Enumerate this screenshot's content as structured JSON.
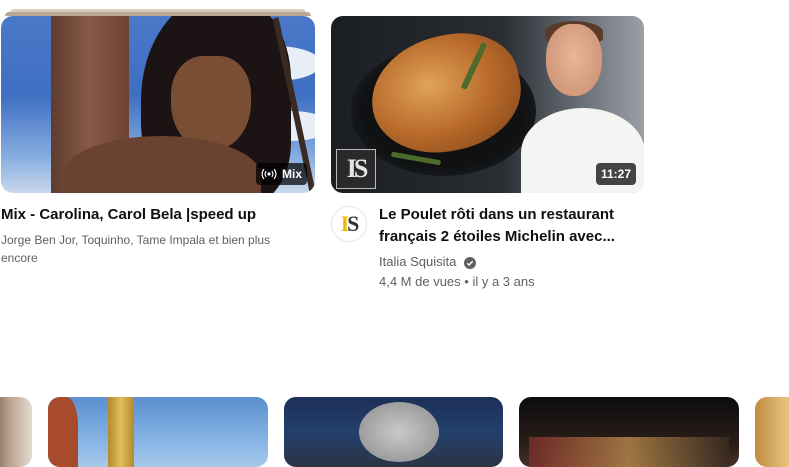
{
  "videos": [
    {
      "title": "Mix - Carolina, Carol Bela |speed up",
      "subtitle": "Jorge Ben Jor, Toquinho, Tame Impala et bien plus encore",
      "badge": "Mix",
      "badge_icon": "radio-broadcast-icon"
    },
    {
      "title_line1": "Le Poulet rôti dans un restaurant",
      "title_line2": "français 2 étoiles Michelin avec...",
      "duration": "11:27",
      "channel": "Italia Squisita",
      "channel_avatar_text": "IS",
      "verified_icon": "verified-check-icon",
      "views": "4,4 M de vues",
      "separator": "•",
      "age": "il y a 3 ans",
      "watermark_text": "IS"
    }
  ],
  "colors": {
    "title": "#0f0f0f",
    "meta": "#606060",
    "badge_bg": "#000000b8",
    "avatar_accent": "#f0b800"
  }
}
